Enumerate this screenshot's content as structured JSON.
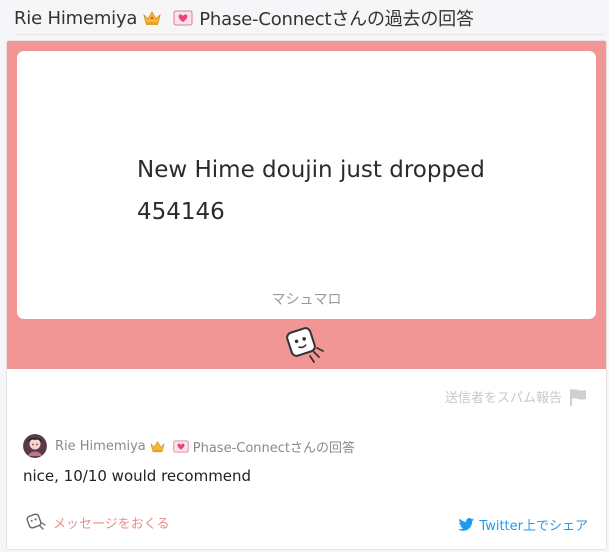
{
  "page": {
    "title_name": "Rie Himemiya",
    "title_suffix": "Phase-Connectさんの過去の回答"
  },
  "question": {
    "text": "New Hime doujin just dropped\n454146",
    "brand": "マシュマロ"
  },
  "report": {
    "label": "送信者をスパム報告"
  },
  "answer": {
    "author": "Rie Himemiya",
    "author_suffix": "Phase-Connectさんの回答",
    "text": "nice, 10/10 would recommend"
  },
  "footer": {
    "send_message_label": "メッセージをおくる",
    "twitter_share_label": "Twitter上でシェア"
  },
  "colors": {
    "accent": "#f29595",
    "twitter": "#1d9bf0",
    "send_link": "#ee8a8a"
  },
  "icons": {
    "crown": "crown-icon",
    "heart": "heart-letter-icon",
    "flag": "flag-icon",
    "mascot": "marshmallow-mascot-icon",
    "twitter": "twitter-bird-icon"
  }
}
